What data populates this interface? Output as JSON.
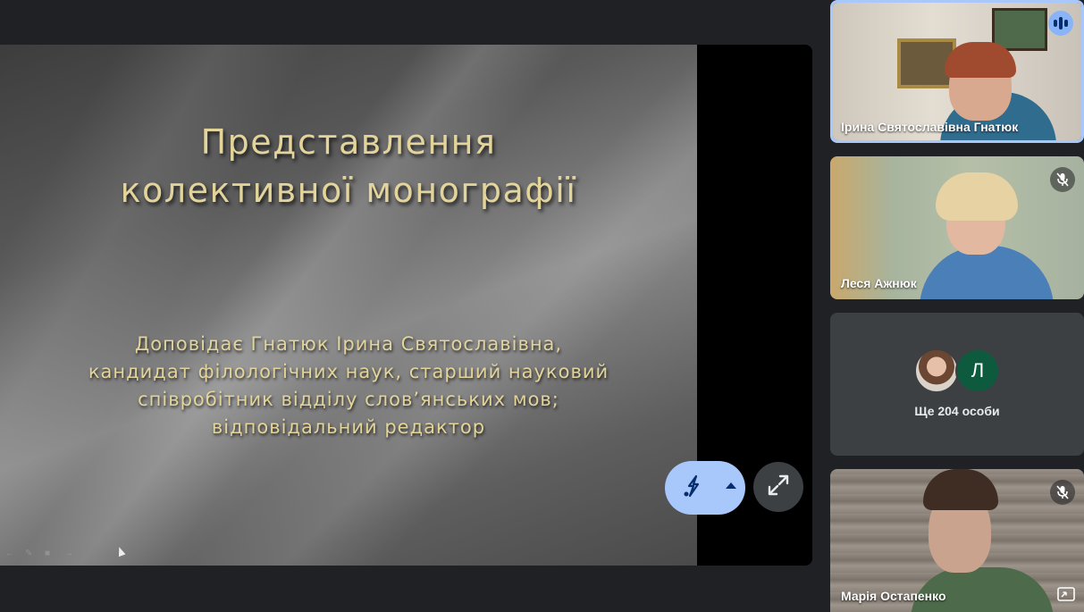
{
  "slide": {
    "title_line1": "Представлення",
    "title_line2": "колективної монографії",
    "sub_line1": "Доповідає Гнатюк Ірина Святославівна,",
    "sub_line2": "кандидат філологічних наук, старший науковий",
    "sub_line3": "співробітник відділу слов’янських мов;",
    "sub_line4": "відповідальний редактор"
  },
  "participants": [
    {
      "name": "Ірина Святославівна Гнатюк",
      "state": "speaking"
    },
    {
      "name": "Леся Ажнюк",
      "state": "muted"
    },
    {
      "name": "Марія Остапенко",
      "state": "muted"
    }
  ],
  "overflow": {
    "avatar_letter": "Л",
    "label": "Ще 204 особи"
  },
  "colors": {
    "accent": "#a8c7fa",
    "tile_bg": "#3c4043",
    "page_bg": "#202124",
    "slide_text": "#e2d49a"
  },
  "icons": {
    "effects": "visual-effects-icon",
    "expand": "expand-icon",
    "speaking": "audio-level-icon",
    "muted": "mic-off-icon",
    "pip": "picture-in-picture-icon"
  }
}
